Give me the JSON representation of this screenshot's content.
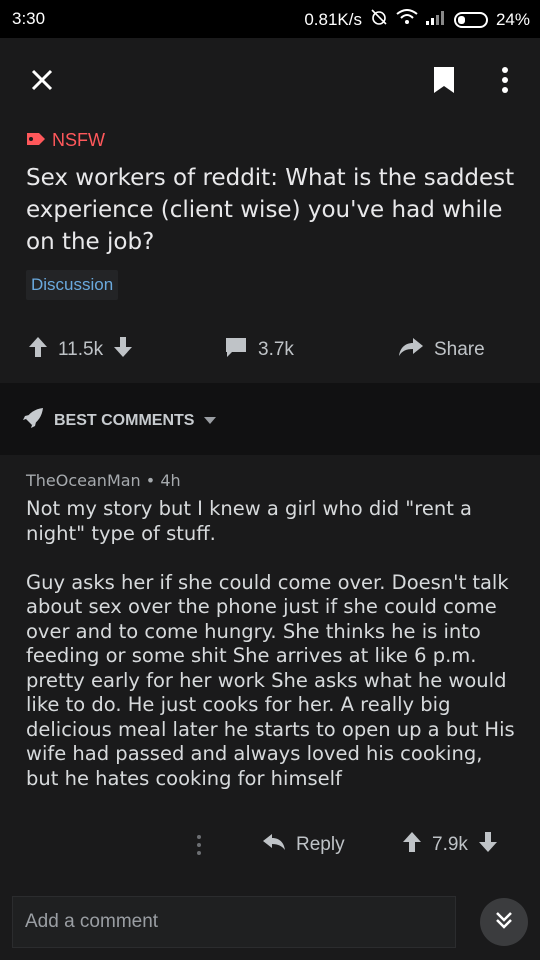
{
  "status": {
    "time": "3:30",
    "speed": "0.81K/s",
    "battery": "24%"
  },
  "post": {
    "nsfw_label": "NSFW",
    "title": "Sex workers of reddit: What is the saddest experience (client wise) you've had while on the job?",
    "flair": "Discussion",
    "upvotes": "11.5k",
    "comments": "3.7k",
    "share_label": "Share"
  },
  "sort": {
    "label": "BEST COMMENTS"
  },
  "comment": {
    "author": "TheOceanMan",
    "age": "4h",
    "paragraphs": [
      "Not my story but I knew a girl who did \"rent a night\" type of stuff.",
      "Guy asks her if she could come over. Doesn't talk about sex over the phone just if she could come over and to come hungry. She thinks he is into feeding or some shit She arrives at like 6 p.m. pretty early for her work She asks what he would like to do. He just cooks for her. A really big delicious meal later he starts to open up a but His wife had passed and always loved his cooking, but he hates cooking for himself"
    ],
    "reply_label": "Reply",
    "score": "7.9k"
  },
  "composer": {
    "placeholder": "Add a comment"
  },
  "colors": {
    "background": "#1a1a1b",
    "nsfw": "#ff585b",
    "flair_text": "#6aa9dd"
  }
}
